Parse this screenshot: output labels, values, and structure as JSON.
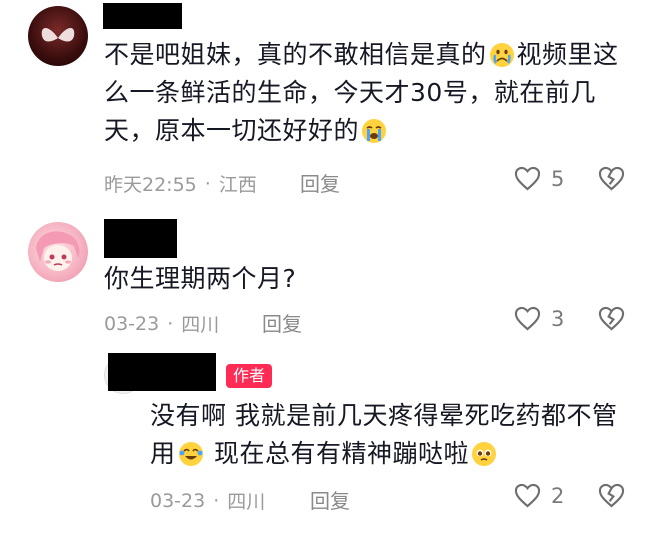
{
  "comments": [
    {
      "text_lines": [
        "不是吧姐妹，真的不敢相信是真的",
        "视频里这",
        "么一条鲜活的生命，今天才30号，就在前几",
        "天，原本一切还好好的"
      ],
      "time": "昨天22:55",
      "location": "江西",
      "reply_label": "回复",
      "likes": "5",
      "avatar_icon": "butterfly-icon"
    },
    {
      "text": "你生理期两个月?",
      "time": "03-23",
      "location": "四川",
      "reply_label": "回复",
      "likes": "3",
      "avatar_icon": "anime-avatar-icon"
    },
    {
      "author_badge": "作者",
      "text_line1": "没有啊 我就是前几天疼得晕死吃药都不管",
      "text_line2_a": "用",
      "text_line2_b": "现在总有有精神蹦哒啦",
      "time": "03-23",
      "location": "四川",
      "reply_label": "回复",
      "likes": "2"
    }
  ],
  "separator": "·",
  "colors": {
    "author_badge": "#fe2c55",
    "meta": "#9a9a9a"
  }
}
